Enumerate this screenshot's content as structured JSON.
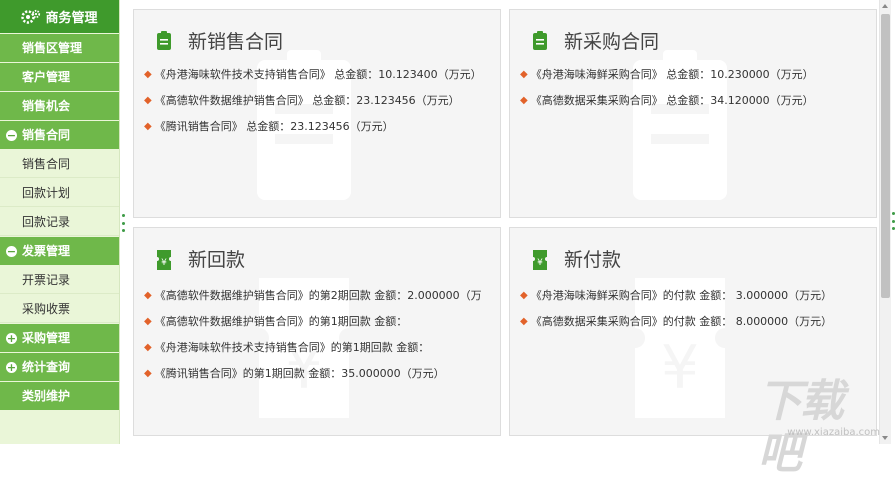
{
  "sidebar": {
    "header": "商务管理",
    "items": [
      {
        "label": "销售区管理",
        "kind": "top"
      },
      {
        "label": "客户管理",
        "kind": "top"
      },
      {
        "label": "销售机会",
        "kind": "top"
      },
      {
        "label": "销售合同",
        "kind": "group",
        "toggle": "−"
      },
      {
        "label": "销售合同",
        "kind": "sub"
      },
      {
        "label": "回款计划",
        "kind": "sub"
      },
      {
        "label": "回款记录",
        "kind": "sub"
      },
      {
        "label": "发票管理",
        "kind": "group",
        "toggle": "−"
      },
      {
        "label": "开票记录",
        "kind": "sub"
      },
      {
        "label": "采购收票",
        "kind": "sub"
      },
      {
        "label": "采购管理",
        "kind": "group",
        "toggle": "+"
      },
      {
        "label": "统计查询",
        "kind": "group",
        "toggle": "+"
      },
      {
        "label": "类别维护",
        "kind": "top"
      }
    ]
  },
  "panels": [
    {
      "title": "新销售合同",
      "icon": "document-icon",
      "items": [
        "《舟港海味软件技术支持销售合同》 总金额：10.123400（万元）",
        "《高德软件数据维护销售合同》 总金额：23.123456（万元）",
        "《腾讯销售合同》 总金额：23.123456（万元）"
      ]
    },
    {
      "title": "新采购合同",
      "icon": "document-icon",
      "items": [
        "《舟港海味海鲜采购合同》 总金额：10.230000（万元）",
        "《高德数据采集采购合同》 总金额：34.120000（万元）"
      ]
    },
    {
      "title": "新回款",
      "icon": "ticket-icon",
      "items": [
        "《高德软件数据维护销售合同》的第2期回款 金额：2.000000（万",
        "《高德软件数据维护销售合同》的第1期回款 金额：",
        "《舟港海味软件技术支持销售合同》的第1期回款 金额：",
        "《腾讯销售合同》的第1期回款 金额：35.000000（万元）"
      ]
    },
    {
      "title": "新付款",
      "icon": "ticket-icon",
      "items": [
        "《舟港海味海鲜采购合同》的付款 金额： 3.000000（万元）",
        "《高德数据采集采购合同》的付款 金额： 8.000000（万元）"
      ]
    }
  ],
  "bullet": "◆",
  "logo": {
    "text": "下载吧",
    "url": "www.xiazaiba.com"
  },
  "colors": {
    "accent": "#3f9a2c",
    "sidebar_green": "#6fb84a",
    "bullet": "#e2622a"
  }
}
